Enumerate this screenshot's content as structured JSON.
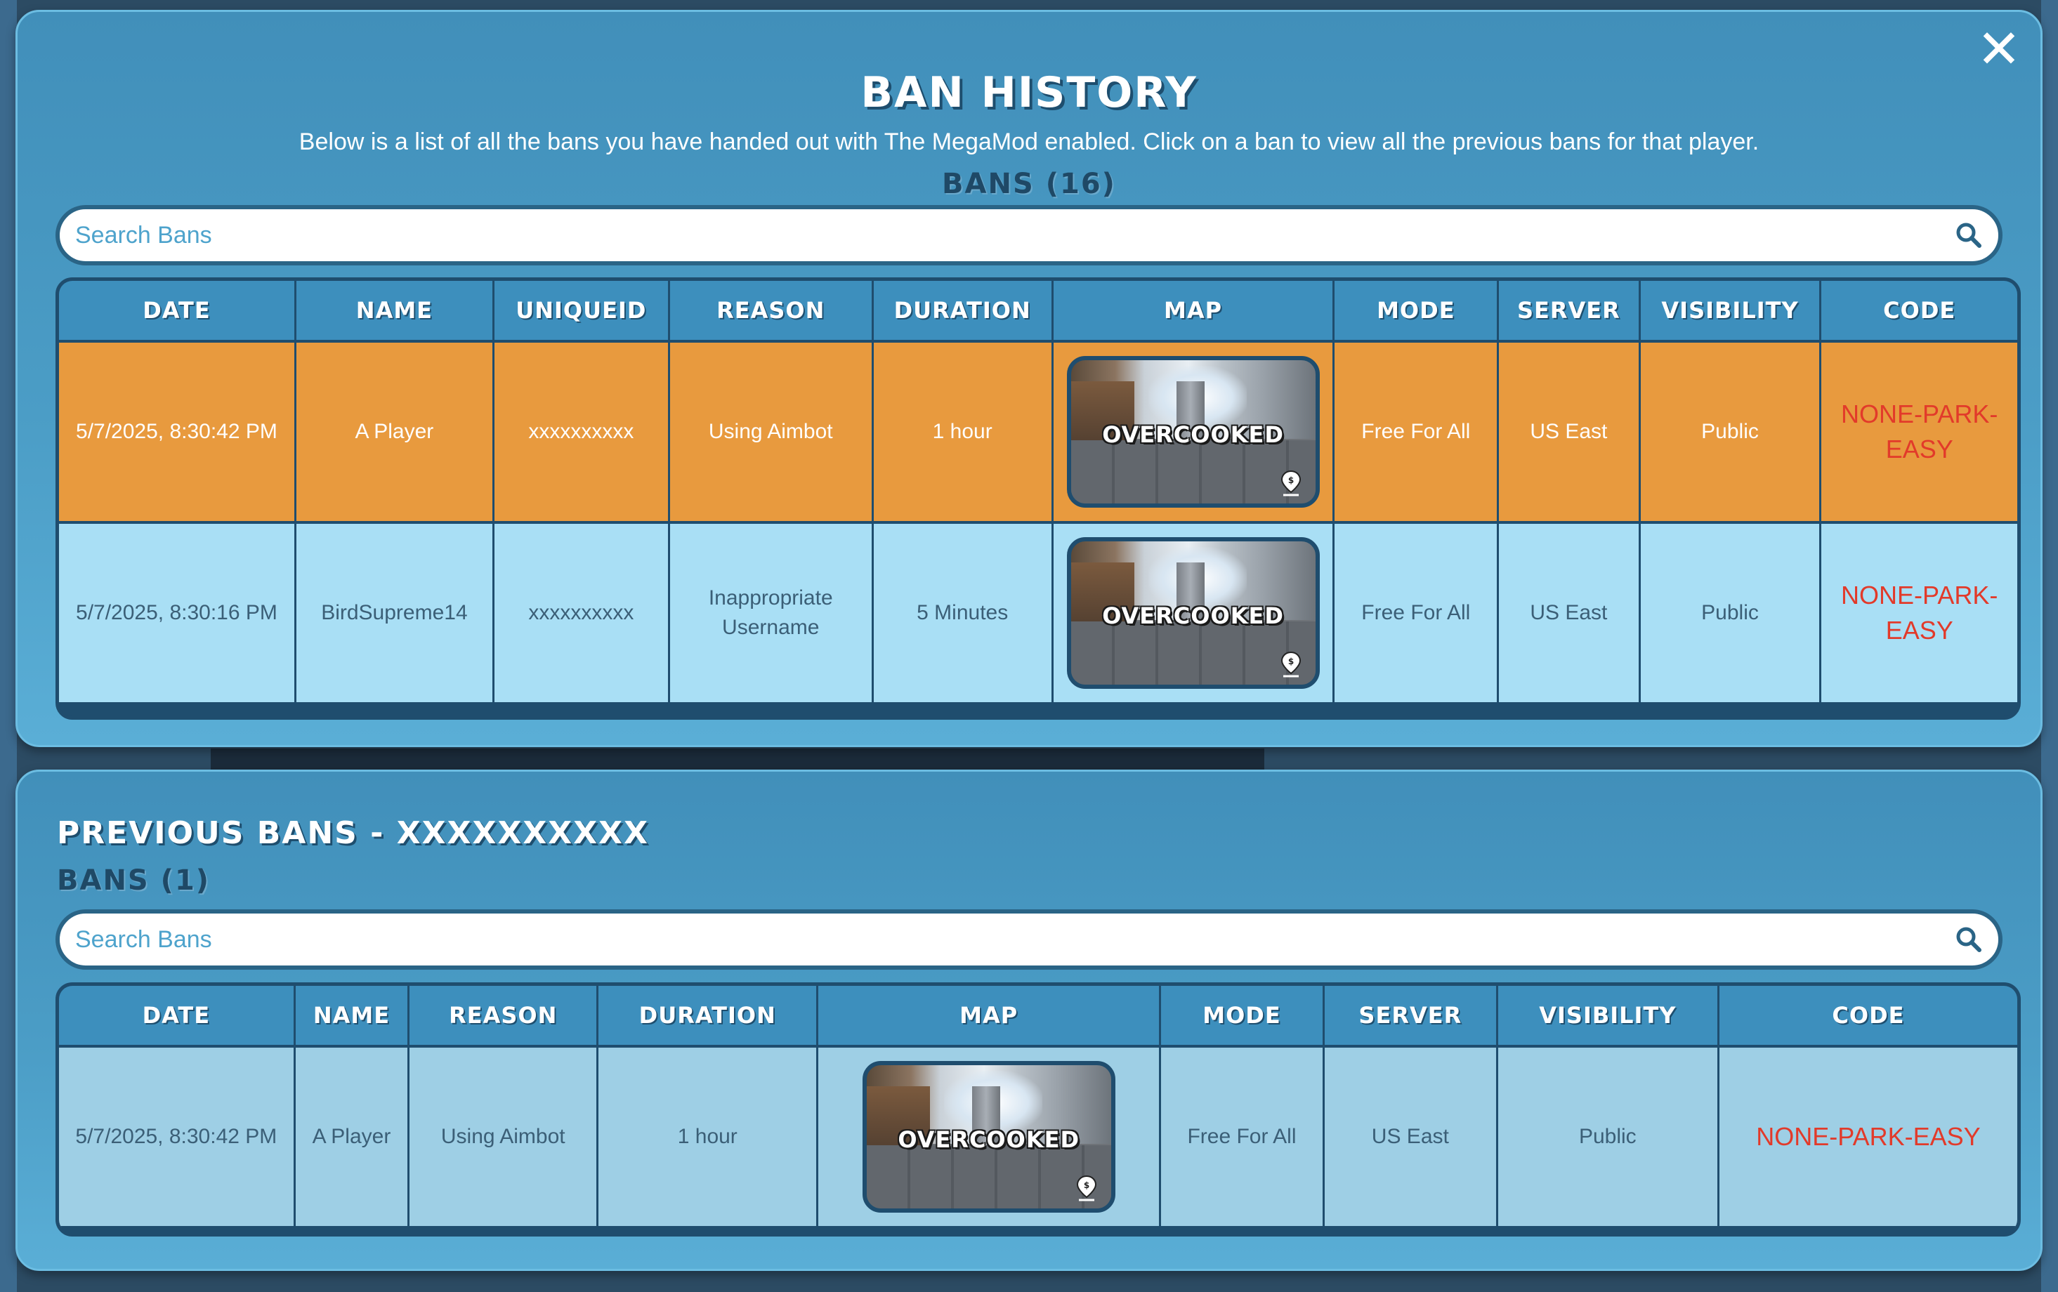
{
  "top_panel": {
    "title": "Ban History",
    "subtitle": "Below is a list of all the bans you have handed out with The MegaMod enabled. Click on a ban to view all the previous bans for that player.",
    "count_label": "Bans (16)",
    "search_placeholder": "Search Bans",
    "columns": [
      "Date",
      "Name",
      "UniqueID",
      "Reason",
      "Duration",
      "Map",
      "Mode",
      "Server",
      "Visibility",
      "Code"
    ],
    "rows": [
      {
        "date": "5/7/2025, 8:30:42 PM",
        "name": "A Player",
        "unique_id": "xxxxxxxxxx",
        "reason": "Using Aimbot",
        "duration": "1 hour",
        "map": "Overcooked",
        "mode": "Free For All",
        "server": "US East",
        "visibility": "Public",
        "code": "NONE-PARK-EASY"
      },
      {
        "date": "5/7/2025, 8:30:16 PM",
        "name": "BirdSupreme14",
        "unique_id": "xxxxxxxxxx",
        "reason": "Inappropriate Username",
        "duration": "5 Minutes",
        "map": "Overcooked",
        "mode": "Free For All",
        "server": "US East",
        "visibility": "Public",
        "code": "NONE-PARK-EASY"
      }
    ]
  },
  "bottom_panel": {
    "title": "Previous Bans - xxxxxxxxxx",
    "count_label": "Bans (1)",
    "search_placeholder": "Search Bans",
    "columns": [
      "Date",
      "Name",
      "Reason",
      "Duration",
      "Map",
      "Mode",
      "Server",
      "Visibility",
      "Code"
    ],
    "rows": [
      {
        "date": "5/7/2025, 8:30:42 PM",
        "name": "A Player",
        "reason": "Using Aimbot",
        "duration": "1 hour",
        "map": "Overcooked",
        "mode": "Free For All",
        "server": "US East",
        "visibility": "Public",
        "code": "NONE-PARK-EASY"
      }
    ]
  },
  "icons": {
    "close": "close-icon",
    "search": "search-icon",
    "map_pin": "map-pin-icon"
  },
  "colors": {
    "panel_blue": "#4b9dc6",
    "header_blue": "#3d8fbd",
    "border_navy": "#1f4d6e",
    "row_highlight": "#e89a3e",
    "row_light": "#a9dff5",
    "code_red": "#e23a2a"
  }
}
